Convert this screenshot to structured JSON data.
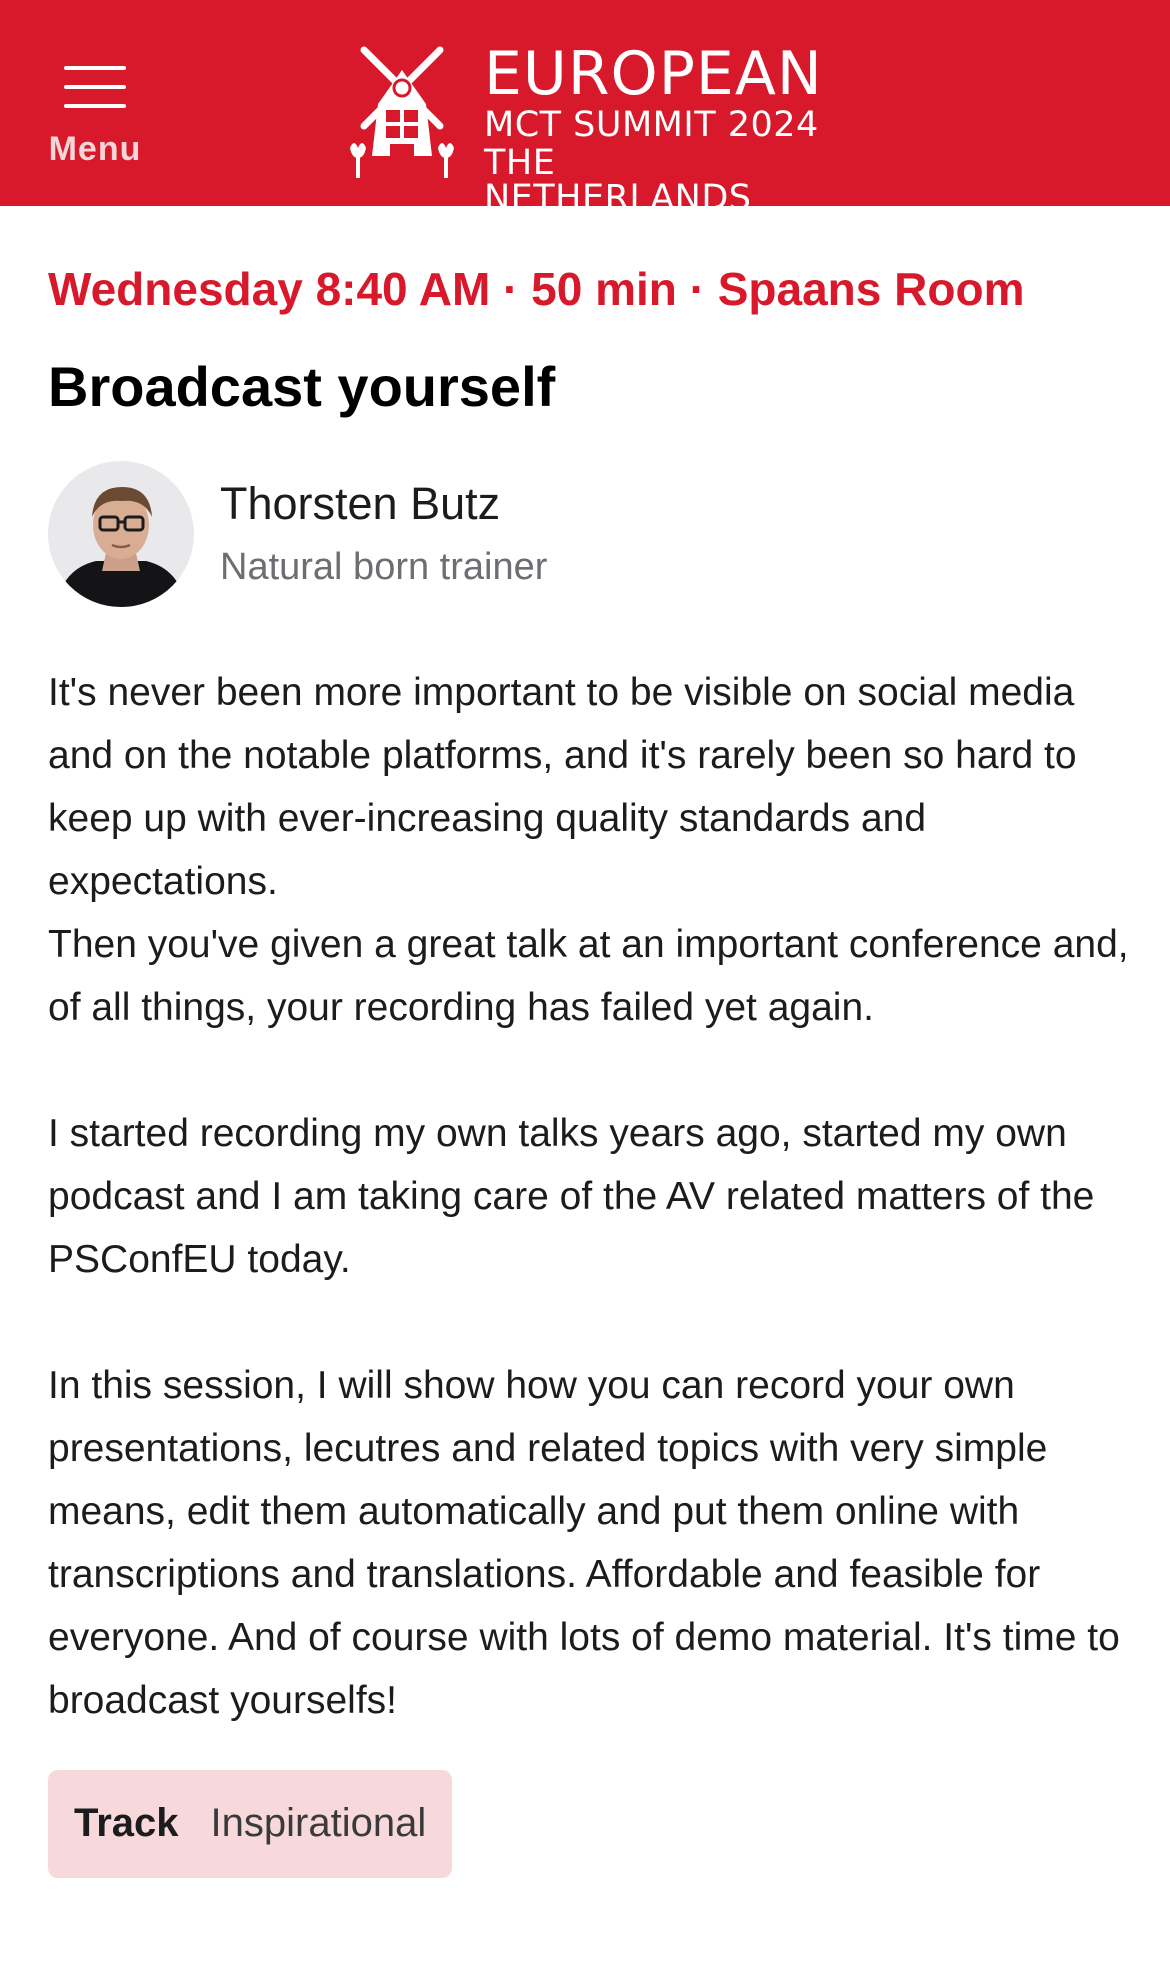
{
  "header": {
    "menu_label": "Menu",
    "logo": {
      "line1": "EUROPEAN",
      "line2": "MCT SUMMIT 2024",
      "line3": "THE NETHERLANDS"
    },
    "background_color": "#d8192b"
  },
  "session": {
    "meta": "Wednesday 8:40 AM · 50 min · Spaans Room",
    "title": "Broadcast yourself",
    "speaker": {
      "name": "Thorsten Butz",
      "tagline": "Natural born trainer"
    },
    "description": [
      "It's never been more important to be visible on social media and on the notable platforms, and it's rarely been so hard to keep up with ever-increasing quality standards and expectations.\nThen you've given a great talk at an important conference and, of all things, your recording has failed yet again.",
      "I started recording my own talks years ago, started my own podcast and I am taking care of the AV related matters of the PSConfEU today.",
      "In this session, I will show how you can record your own presentations, lecutres and related topics with very simple means, edit them automatically and put them online with transcriptions and translations. Affordable and feasible for everyone. And of course with lots of demo material. It's time to broadcast yourselfs!"
    ],
    "track": {
      "label": "Track",
      "value": "Inspirational"
    }
  },
  "icons": {
    "menu": "hamburger-icon",
    "logo": "windmill-logo-icon"
  },
  "colors": {
    "accent": "#d8192b",
    "track_bg": "#f7d9dc"
  }
}
